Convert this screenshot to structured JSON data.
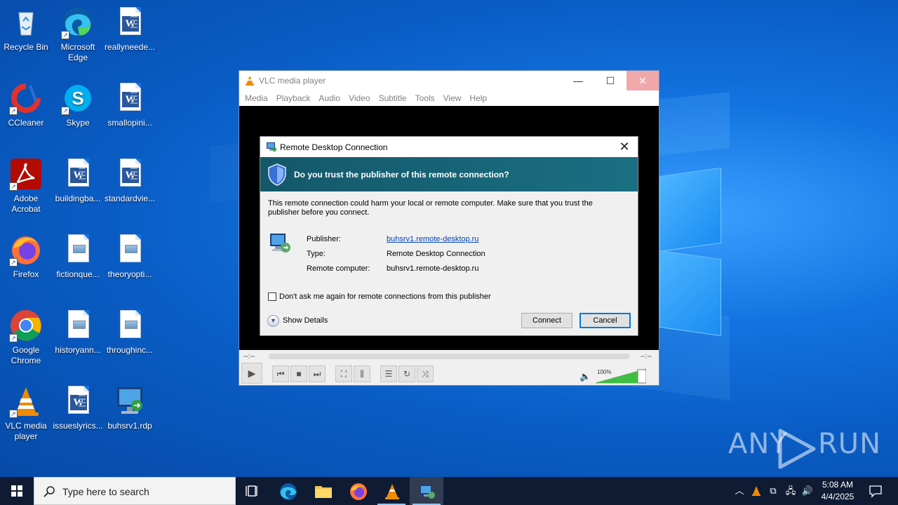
{
  "desktop": {
    "icons": [
      {
        "label": "Recycle Bin"
      },
      {
        "label": "Microsoft Edge"
      },
      {
        "label": "reallyneede..."
      },
      {
        "label": "CCleaner"
      },
      {
        "label": "Skype"
      },
      {
        "label": "smallopini..."
      },
      {
        "label": "Adobe Acrobat"
      },
      {
        "label": "buildingba..."
      },
      {
        "label": "standardvie..."
      },
      {
        "label": "Firefox"
      },
      {
        "label": "fictionque..."
      },
      {
        "label": "theoryopti..."
      },
      {
        "label": "Google Chrome"
      },
      {
        "label": "historyann..."
      },
      {
        "label": "throughinc..."
      },
      {
        "label": "VLC media player"
      },
      {
        "label": "issueslyrics..."
      },
      {
        "label": "buhsrv1.rdp"
      }
    ]
  },
  "vlc": {
    "title": "VLC media player",
    "window_buttons": {
      "minimize": "—",
      "maximize": "☐",
      "close": "✕"
    },
    "menu": [
      "Media",
      "Playback",
      "Audio",
      "Video",
      "Subtitle",
      "Tools",
      "View",
      "Help"
    ],
    "time_elapsed": "--:--",
    "time_total": "--:--",
    "volume": "100%",
    "volume_level": 1.0
  },
  "rdp_dialog": {
    "title": "Remote Desktop Connection",
    "close": "✕",
    "question": "Do you trust the publisher of this remote connection?",
    "warning": "This remote connection could harm your local or remote computer. Make sure that you trust the publisher before you connect.",
    "fields": {
      "publisher_label": "Publisher:",
      "publisher_value": "buhsrv1.remote-desktop.ru",
      "type_label": "Type:",
      "type_value": "Remote Desktop Connection",
      "computer_label": "Remote computer:",
      "computer_value": "buhsrv1.remote-desktop.ru"
    },
    "checkbox_label": "Don't ask me again for remote connections from this publisher",
    "show_details": "Show Details",
    "connect": "Connect",
    "cancel": "Cancel"
  },
  "watermark": {
    "left": "ANY",
    "right": "RUN"
  },
  "taskbar": {
    "search_placeholder": "Type here to search",
    "time": "5:08 AM",
    "date": "4/4/2025"
  },
  "colors": {
    "accent": "#0078d7",
    "rdp_banner": "#1a6f82",
    "taskbar": "#0f1b33",
    "vlc_orange": "#f08a00"
  }
}
